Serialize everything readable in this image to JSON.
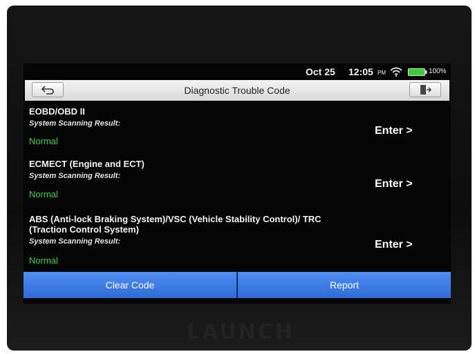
{
  "device": {
    "brand": "LAUNCH"
  },
  "status_bar": {
    "date": "Oct 25",
    "time": "12:05",
    "ampm": "PM",
    "battery": "100%"
  },
  "header": {
    "title": "Diagnostic Trouble Code"
  },
  "systems": [
    {
      "name": "EOBD/OBD II",
      "result_label": "System Scanning Result:",
      "result": "Normal",
      "action": "Enter >"
    },
    {
      "name": "ECMECT (Engine and ECT)",
      "result_label": "System Scanning Result:",
      "result": "Normal",
      "action": "Enter >"
    },
    {
      "name": "ABS (Anti-lock Braking System)/VSC (Vehicle Stability Control)/ TRC (Traction Control System)",
      "result_label": "System Scanning Result:",
      "result": "Normal",
      "action": "Enter >"
    }
  ],
  "footer": {
    "clear_code": "Clear Code",
    "report": "Report"
  },
  "colors": {
    "accent": "#3a7be3",
    "normal": "#3bd13b",
    "battery": "#36d036"
  }
}
